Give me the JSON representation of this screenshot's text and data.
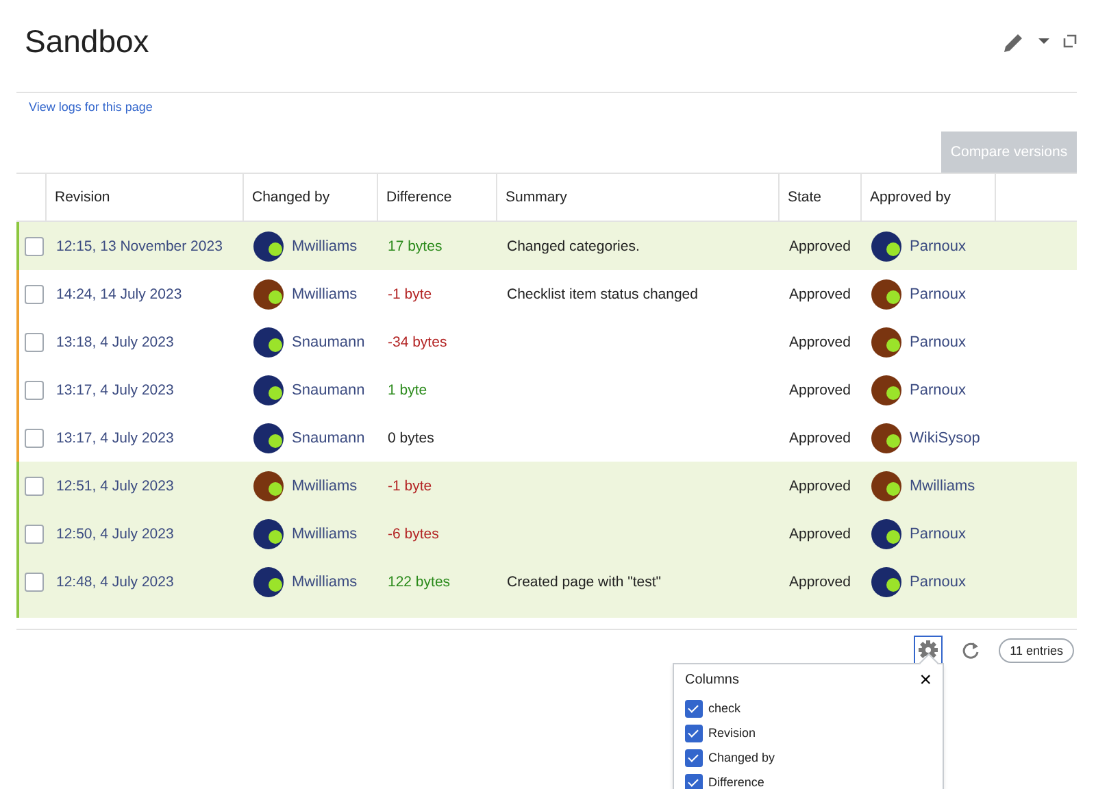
{
  "page": {
    "title": "Sandbox",
    "logs_link": "View logs for this page"
  },
  "toolbar": {
    "compare_button": {
      "label": "Compare versions",
      "disabled": true
    }
  },
  "table": {
    "columns": [
      "Revision",
      "Changed by",
      "Difference",
      "Summary",
      "State",
      "Approved by"
    ],
    "rows": [
      {
        "checked": false,
        "highlighted": true,
        "color": "#8cc63f",
        "revision": "12:15, 13 November 2023",
        "changed_by": {
          "name": "Mwilliams",
          "color": "#1a2a6c"
        },
        "difference": {
          "text": "17 bytes",
          "kind": "positive"
        },
        "summary": "Changed categories.",
        "state": "Approved",
        "approved_by": {
          "name": "Parnoux",
          "color": "#1a2a6c"
        }
      },
      {
        "checked": false,
        "highlighted": false,
        "color": "#f0a030",
        "revision": "14:24, 14 July 2023",
        "changed_by": {
          "name": "Mwilliams",
          "color": "#7a3510"
        },
        "difference": {
          "text": "-1 byte",
          "kind": "negative"
        },
        "summary": "Checklist item status changed",
        "state": "Approved",
        "approved_by": {
          "name": "Parnoux",
          "color": "#7a3510"
        }
      },
      {
        "checked": false,
        "highlighted": false,
        "color": "#f0a030",
        "revision": "13:18, 4 July 2023",
        "changed_by": {
          "name": "Snaumann",
          "color": "#1a2a6c"
        },
        "difference": {
          "text": "-34 bytes",
          "kind": "negative"
        },
        "state": "Approved",
        "approved_by": {
          "name": "Parnoux",
          "color": "#7a3510"
        }
      },
      {
        "checked": false,
        "highlighted": false,
        "color": "#f0a030",
        "revision": "13:17, 4 July 2023",
        "changed_by": {
          "name": "Snaumann",
          "color": "#1a2a6c"
        },
        "difference": {
          "text": "1 byte",
          "kind": "positive"
        },
        "state": "Approved",
        "approved_by": {
          "name": "Parnoux",
          "color": "#7a3510"
        }
      },
      {
        "checked": false,
        "highlighted": false,
        "color": "#f0a030",
        "revision": "13:17, 4 July 2023",
        "changed_by": {
          "name": "Snaumann",
          "color": "#1a2a6c"
        },
        "difference": {
          "text": "0 bytes",
          "kind": "neutral"
        },
        "state": "Approved",
        "approved_by": {
          "name": "WikiSysop",
          "color": "#7a3510"
        }
      },
      {
        "checked": false,
        "highlighted": true,
        "color": "#8cc63f",
        "revision": "12:51, 4 July 2023",
        "changed_by": {
          "name": "Mwilliams",
          "color": "#7a3510"
        },
        "difference": {
          "text": "-1 byte",
          "kind": "negative"
        },
        "state": "Approved",
        "approved_by": {
          "name": "Mwilliams",
          "color": "#7a3510"
        }
      },
      {
        "checked": false,
        "highlighted": true,
        "color": "#8cc63f",
        "revision": "12:50, 4 July 2023",
        "changed_by": {
          "name": "Mwilliams",
          "color": "#1a2a6c"
        },
        "difference": {
          "text": "-6 bytes",
          "kind": "negative"
        },
        "state": "Approved",
        "approved_by": {
          "name": "Parnoux",
          "color": "#1a2a6c"
        }
      },
      {
        "checked": false,
        "highlighted": true,
        "color": "#8cc63f",
        "revision": "12:48, 4 July 2023",
        "changed_by": {
          "name": "Mwilliams",
          "color": "#1a2a6c"
        },
        "difference": {
          "text": "122 bytes",
          "kind": "positive"
        },
        "summary": "Created page with \"test\"",
        "state": "Approved",
        "approved_by": {
          "name": "Parnoux",
          "color": "#1a2a6c"
        }
      }
    ]
  },
  "footer": {
    "settings_open": true,
    "entries": "11 entries"
  },
  "columns_popup": {
    "title": "Columns",
    "close": "×",
    "items": [
      {
        "label": "check",
        "checked": true
      },
      {
        "label": "Revision",
        "checked": true
      },
      {
        "label": "Changed by",
        "checked": true
      },
      {
        "label": "Difference",
        "checked": true
      }
    ]
  }
}
